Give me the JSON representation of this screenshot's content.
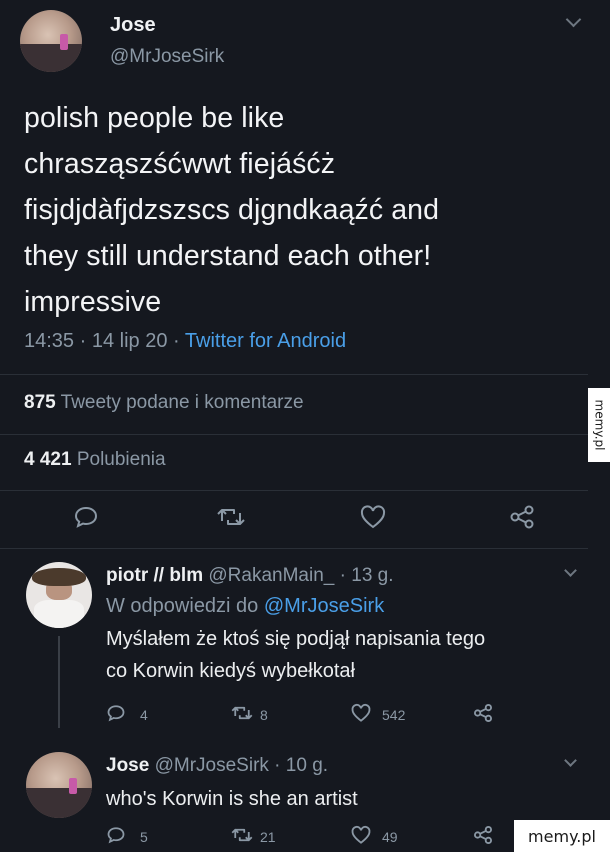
{
  "main_tweet": {
    "author_name": "Jose",
    "author_handle": "@MrJoseSirk",
    "text_lines": [
      "polish people be like",
      "chrasząszśćwwt fiejáśćż",
      "fisjdjdàfjdzszscs djgndkaąźć and",
      "they still understand each other!",
      "impressive"
    ],
    "time": "14:35",
    "date": "14 lip 20",
    "separator": "·",
    "source": "Twitter for Android",
    "retweets_count": "875",
    "retweets_label": "Tweety podane i komentarze",
    "likes_count": "4 421",
    "likes_label": "Polubienia"
  },
  "replies": [
    {
      "author_name": "piotr // blm",
      "author_handle": "@RakanMain_",
      "age": "· 13 g.",
      "in_reply_prefix": "W odpowiedzi do",
      "in_reply_mention": "@MrJoseSirk",
      "text_lines": [
        "Myślałem że ktoś się podjął napisania tego",
        "co Korwin kiedyś wybełkotał"
      ],
      "reply_count": "4",
      "retweet_count": "8",
      "like_count": "542"
    },
    {
      "author_name": "Jose",
      "author_handle": "@MrJoseSirk",
      "age": "· 10 g.",
      "text_lines": [
        "who's Korwin is she an artist"
      ],
      "reply_count": "5",
      "retweet_count": "21",
      "like_count": "49"
    }
  ],
  "watermarks": {
    "side": "memy.pl",
    "corner": "memy.pl"
  },
  "colors": {
    "background": "#15181f",
    "link_blue": "#4a9fe8",
    "muted_gray": "#8b98a5"
  },
  "icons": [
    "comment-icon",
    "retweet-icon",
    "like-icon",
    "share-icon",
    "chevron-down-icon"
  ]
}
